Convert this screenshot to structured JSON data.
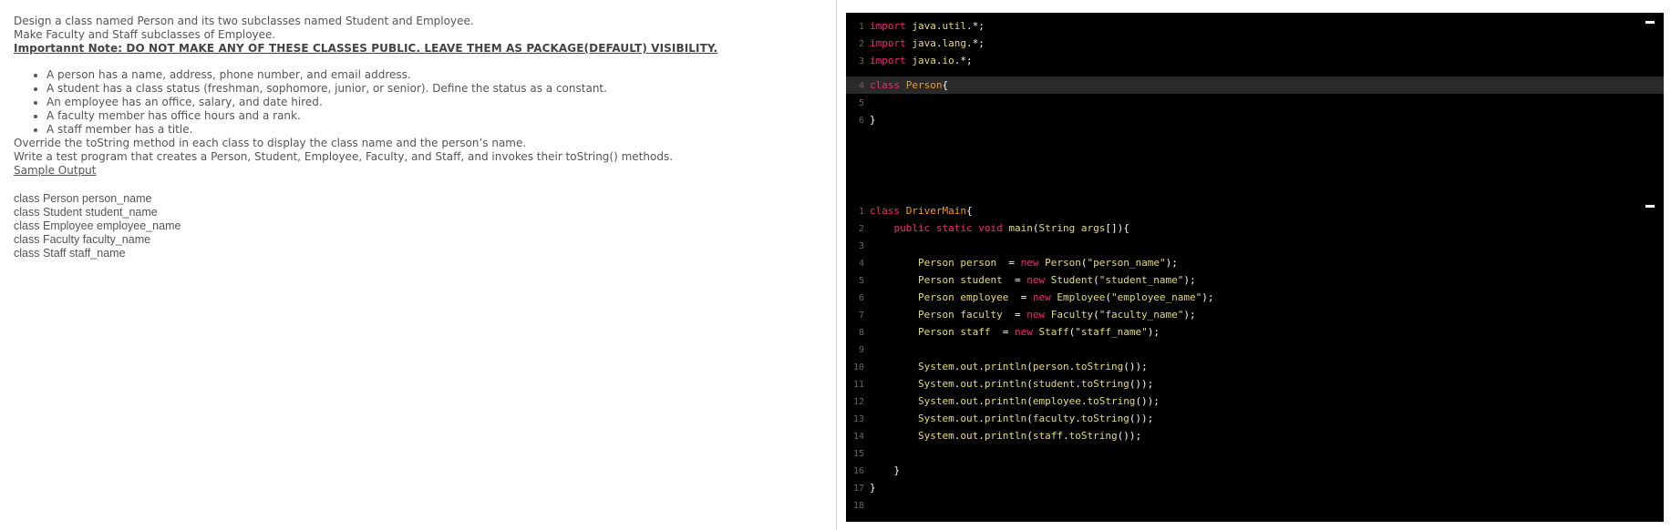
{
  "problem": {
    "intro_1": "Design a class named Person and its two subclasses named Student and Employee.",
    "intro_2": "Make Faculty and Staff subclasses of Employee.",
    "important_note": "Importannt Note: DO NOT MAKE ANY OF THESE CLASSES PUBLIC. LEAVE THEM AS PACKAGE(DEFAULT) VISIBILITY.",
    "requirements": [
      "A person has a name, address, phone number, and email  address.",
      "A student has a class status (freshman, sophomore, junior, or senior). Define the status as a constant.",
      "An employee has an office, salary, and date hired.",
      "A faculty member has office hours and a rank.",
      "A staff member has a title."
    ],
    "override_1": "Override the toString method in each class to display the class name and the person’s name.",
    "override_2": "Write a test program that creates a Person, Student, Employee, Faculty, and Staff, and invokes their toString() methods.",
    "sample_output_title": "Sample Output",
    "sample_output": [
      "class Person person_name",
      "class Student student_name",
      "class Employee employee_name",
      "class Faculty faculty_name",
      "class Staff staff_name"
    ]
  },
  "editor": {
    "imports": [
      {
        "num": "1",
        "text": "import java.util.*;"
      },
      {
        "num": "2",
        "text": "import java.lang.*;"
      },
      {
        "num": "3",
        "text": "import java.io.*;"
      }
    ],
    "person_class": [
      {
        "num": "4",
        "text": "class Person{"
      },
      {
        "num": "5",
        "text": ""
      },
      {
        "num": "6",
        "text": "}"
      }
    ],
    "driver": [
      {
        "num": "1",
        "text": "class DriverMain{"
      },
      {
        "num": "2",
        "text": "    public static void main(String args[]){"
      },
      {
        "num": "3",
        "text": ""
      },
      {
        "num": "4",
        "text": "        Person person  = new Person(\"person_name\");"
      },
      {
        "num": "5",
        "text": "        Person student  = new Student(\"student_name\");"
      },
      {
        "num": "6",
        "text": "        Person employee  = new Employee(\"employee_name\");"
      },
      {
        "num": "7",
        "text": "        Person faculty  = new Faculty(\"faculty_name\");"
      },
      {
        "num": "8",
        "text": "        Person staff  = new Staff(\"staff_name\");"
      },
      {
        "num": "9",
        "text": ""
      },
      {
        "num": "10",
        "text": "        System.out.println(person.toString());"
      },
      {
        "num": "11",
        "text": "        System.out.println(student.toString());"
      },
      {
        "num": "12",
        "text": "        System.out.println(employee.toString());"
      },
      {
        "num": "13",
        "text": "        System.out.println(faculty.toString());"
      },
      {
        "num": "14",
        "text": "        System.out.println(staff.toString());"
      },
      {
        "num": "15",
        "text": ""
      },
      {
        "num": "16",
        "text": "    }"
      },
      {
        "num": "17",
        "text": "}"
      },
      {
        "num": "18",
        "text": ""
      }
    ]
  }
}
